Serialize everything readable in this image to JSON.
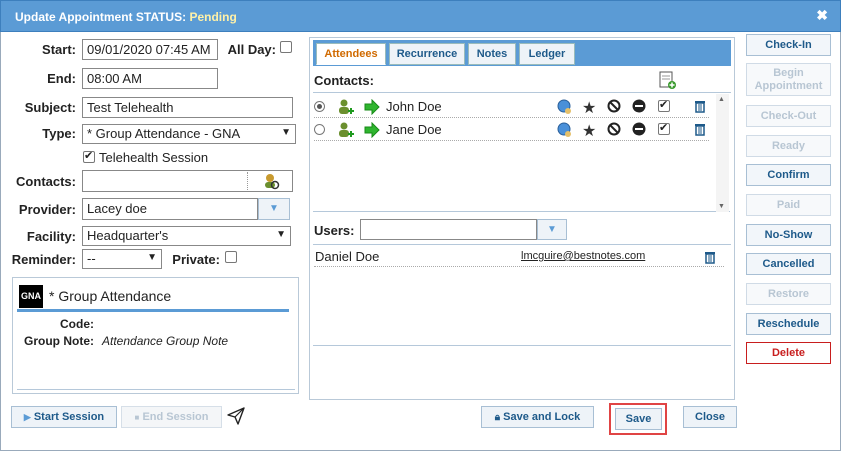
{
  "dialog": {
    "title": "Update Appointment STATUS:",
    "status": "Pending",
    "close_icon": "close-icon"
  },
  "form": {
    "start_label": "Start:",
    "start_value": "09/01/2020 07:45 AM",
    "allday_label": "All Day:",
    "end_label": "End:",
    "end_value": "08:00 AM",
    "subject_label": "Subject:",
    "subject_value": "Test Telehealth",
    "type_label": "Type:",
    "type_value": "* Group Attendance - GNA",
    "telehealth_label": "Telehealth Session",
    "contacts_label": "Contacts:",
    "contacts_value": "",
    "provider_label": "Provider:",
    "provider_value": "Lacey doe",
    "facility_label": "Facility:",
    "facility_value": "Headquarter's",
    "reminder_label": "Reminder:",
    "reminder_value": "--",
    "private_label": "Private:"
  },
  "appointment_type": {
    "badge": "GNA",
    "name": "* Group Attendance",
    "code_label": "Code:",
    "code_value": "",
    "group_note_label": "Group Note:",
    "group_note_value": "Attendance Group Note"
  },
  "tabs": [
    "Attendees",
    "Recurrence",
    "Notes",
    "Ledger"
  ],
  "attendees": {
    "contacts_label": "Contacts:",
    "contacts": [
      {
        "name": "John Doe",
        "selected": true,
        "checked": true
      },
      {
        "name": "Jane Doe",
        "selected": false,
        "checked": true
      }
    ],
    "users_label": "Users:",
    "users": [
      {
        "name": "Daniel Doe",
        "email": "lmcguire@bestnotes.com"
      }
    ]
  },
  "side_buttons": [
    {
      "label": "Check-In",
      "enabled": true
    },
    {
      "label": "Begin Appointment",
      "enabled": false
    },
    {
      "label": "Check-Out",
      "enabled": false
    },
    {
      "label": "Ready",
      "enabled": false
    },
    {
      "label": "Confirm",
      "enabled": true
    },
    {
      "label": "Paid",
      "enabled": false
    },
    {
      "label": "No-Show",
      "enabled": true
    },
    {
      "label": "Cancelled",
      "enabled": true
    },
    {
      "label": "Restore",
      "enabled": false
    },
    {
      "label": "Reschedule",
      "enabled": true
    },
    {
      "label": "Delete",
      "enabled": true
    }
  ],
  "footer": {
    "start_session": "Start Session",
    "end_session": "End Session",
    "save_and_lock": "Save and Lock",
    "save": "Save",
    "close": "Close"
  },
  "colors": {
    "header": "#5b9bd5",
    "status": "#fff1a8",
    "button_text": "#1e5a8a",
    "delete": "#c81e1e",
    "active_tab": "#d06a00",
    "save_highlight": "#e04444"
  }
}
